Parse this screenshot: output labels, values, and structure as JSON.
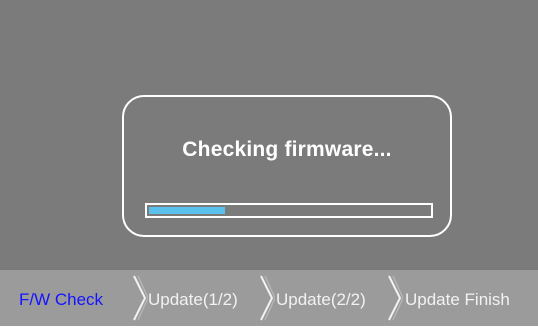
{
  "dialog": {
    "message": "Checking firmware...",
    "progress_percent": 27
  },
  "steps": [
    {
      "label": "F/W Check",
      "state": "active"
    },
    {
      "label": "Update(1/2)",
      "state": "pending"
    },
    {
      "label": "Update(2/2)",
      "state": "pending"
    },
    {
      "label": "Update Finish",
      "state": "pending"
    }
  ],
  "colors": {
    "background": "#7b7b7b",
    "step_bar": "#9b9b9b",
    "active_step": "#1414ff",
    "inactive_step": "#f2f2f2",
    "progress_fill": "#5ac1ec",
    "frame": "#ffffff"
  },
  "icons": {
    "step_separator": "chevron-right-icon"
  }
}
